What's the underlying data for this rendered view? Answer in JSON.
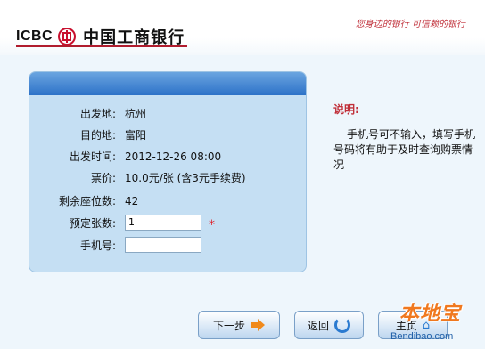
{
  "header": {
    "logo_en": "ICBC",
    "logo_cn": "中国工商银行",
    "slogan": "您身边的银行 可信赖的银行"
  },
  "form": {
    "rows": [
      {
        "label": "出发地:",
        "value": "杭州"
      },
      {
        "label": "目的地:",
        "value": "富阳"
      },
      {
        "label": "出发时间:",
        "value": "2012-12-26 08:00"
      },
      {
        "label": "票价:",
        "value": "10.0元/张 (含3元手续费)"
      },
      {
        "label": "剩余座位数:",
        "value": "42"
      }
    ],
    "ticket_count": {
      "label": "预定张数:",
      "value": "1",
      "required_mark": "*"
    },
    "phone": {
      "label": "手机号:",
      "value": ""
    }
  },
  "note": {
    "title": "说明:",
    "body": "手机号可不输入，填写手机号码将有助于及时查询购票情况"
  },
  "buttons": {
    "next": "下一步",
    "back": "返回",
    "home": "主页"
  },
  "watermark": {
    "cn": "本地宝",
    "en": "Bendibao.com"
  },
  "colors": {
    "panel": "#c5dff3",
    "panel_header": "#2d72c8",
    "accent_red": "#c0303a",
    "page_bg": "#eef6fc"
  },
  "icons": {
    "next": "arrow-right-icon",
    "back": "refresh-icon",
    "home": "home-icon",
    "logo": "icbc-logo-icon"
  }
}
